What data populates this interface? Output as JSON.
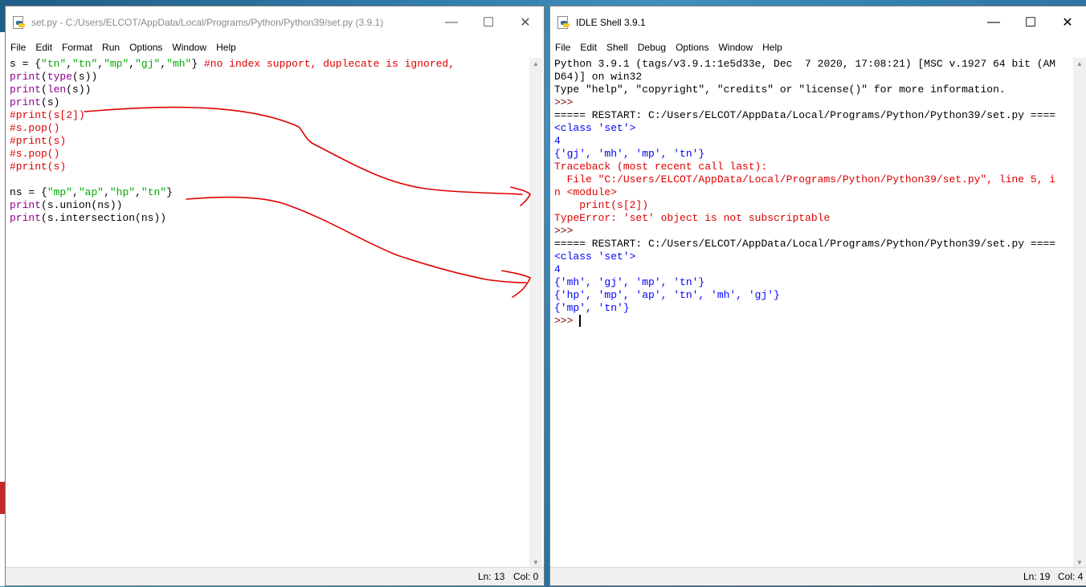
{
  "editor_window": {
    "title": "set.py - C:/Users/ELCOT/AppData/Local/Programs/Python/Python39/set.py (3.9.1)",
    "menu": [
      "File",
      "Edit",
      "Format",
      "Run",
      "Options",
      "Window",
      "Help"
    ],
    "code_lines": [
      {
        "plain": "s = {",
        "s1": "\"tn\"",
        "c1": ",",
        "s2": "\"tn\"",
        "c2": ",",
        "s3": "\"mp\"",
        "c3": ",",
        "s4": "\"gj\"",
        "c4": ",",
        "s5": "\"mh\"",
        "end": "} ",
        "comment": "#no index support, duplecate is ignored,"
      },
      {
        "builtin": "print",
        "rest1": "(",
        "builtin2": "type",
        "rest2": "(s))"
      },
      {
        "builtin": "print",
        "rest1": "(",
        "builtin2": "len",
        "rest2": "(s))"
      },
      {
        "builtin": "print",
        "rest1": "(s)"
      },
      {
        "comment": "#print(s[2])"
      },
      {
        "comment": "#s.pop()"
      },
      {
        "comment": "#print(s)"
      },
      {
        "comment": "#s.pop()"
      },
      {
        "comment": "#print(s)"
      },
      {
        "empty": ""
      },
      {
        "plain": "ns = {",
        "s1": "\"mp\"",
        "c1": ",",
        "s2": "\"ap\"",
        "c2": ",",
        "s3": "\"hp\"",
        "c3": ",",
        "s4": "\"tn\"",
        "end": "}"
      },
      {
        "builtin": "print",
        "rest1": "(s.union(ns))"
      },
      {
        "builtin": "print",
        "rest1": "(s.intersection(ns))"
      }
    ],
    "status": {
      "ln": "Ln: 13",
      "col": "Col: 0"
    },
    "buttons": {
      "minimize": "—",
      "maximize": "☐",
      "close": "✕"
    }
  },
  "shell_window": {
    "title": "IDLE Shell 3.9.1",
    "menu": [
      "File",
      "Edit",
      "Shell",
      "Debug",
      "Options",
      "Window",
      "Help"
    ],
    "lines": [
      {
        "text": "Python 3.9.1 (tags/v3.9.1:1e5d33e, Dec  7 2020, 17:08:21) [MSC v.1927 64 bit (AM",
        "color": "black"
      },
      {
        "text": "D64)] on win32",
        "color": "black"
      },
      {
        "text": "Type \"help\", \"copyright\", \"credits\" or \"license()\" for more information.",
        "color": "black"
      },
      {
        "text": ">>> ",
        "color": "brown"
      },
      {
        "text": "===== RESTART: C:/Users/ELCOT/AppData/Local/Programs/Python/Python39/set.py ====",
        "color": "black"
      },
      {
        "text": "<class 'set'>",
        "color": "blue"
      },
      {
        "text": "4",
        "color": "blue"
      },
      {
        "text": "{'gj', 'mh', 'mp', 'tn'}",
        "color": "blue"
      },
      {
        "text": "Traceback (most recent call last):",
        "color": "red"
      },
      {
        "text": "  File \"C:/Users/ELCOT/AppData/Local/Programs/Python/Python39/set.py\", line 5, i",
        "color": "red"
      },
      {
        "text": "n <module>",
        "color": "red"
      },
      {
        "text": "    print(s[2])",
        "color": "red"
      },
      {
        "text": "TypeError: 'set' object is not subscriptable",
        "color": "red"
      },
      {
        "text": ">>> ",
        "color": "brown"
      },
      {
        "text": "===== RESTART: C:/Users/ELCOT/AppData/Local/Programs/Python/Python39/set.py ====",
        "color": "black"
      },
      {
        "text": "<class 'set'>",
        "color": "blue"
      },
      {
        "text": "4",
        "color": "blue"
      },
      {
        "text": "{'mh', 'gj', 'mp', 'tn'}",
        "color": "blue"
      },
      {
        "text": "{'hp', 'mp', 'ap', 'tn', 'mh', 'gj'}",
        "color": "blue"
      },
      {
        "text": "{'mp', 'tn'}",
        "color": "blue"
      }
    ],
    "prompt": ">>> ",
    "status": {
      "ln": "Ln: 19",
      "col": "Col: 4"
    },
    "buttons": {
      "minimize": "—",
      "maximize": "☐",
      "close": "✕"
    }
  },
  "colors": {
    "keyword_builtin": "#900090",
    "string": "#00aa00",
    "comment": "#dd0000",
    "stdout": "#0000ff",
    "stderr": "#dd0000",
    "annotation_pen": "#e00000"
  }
}
